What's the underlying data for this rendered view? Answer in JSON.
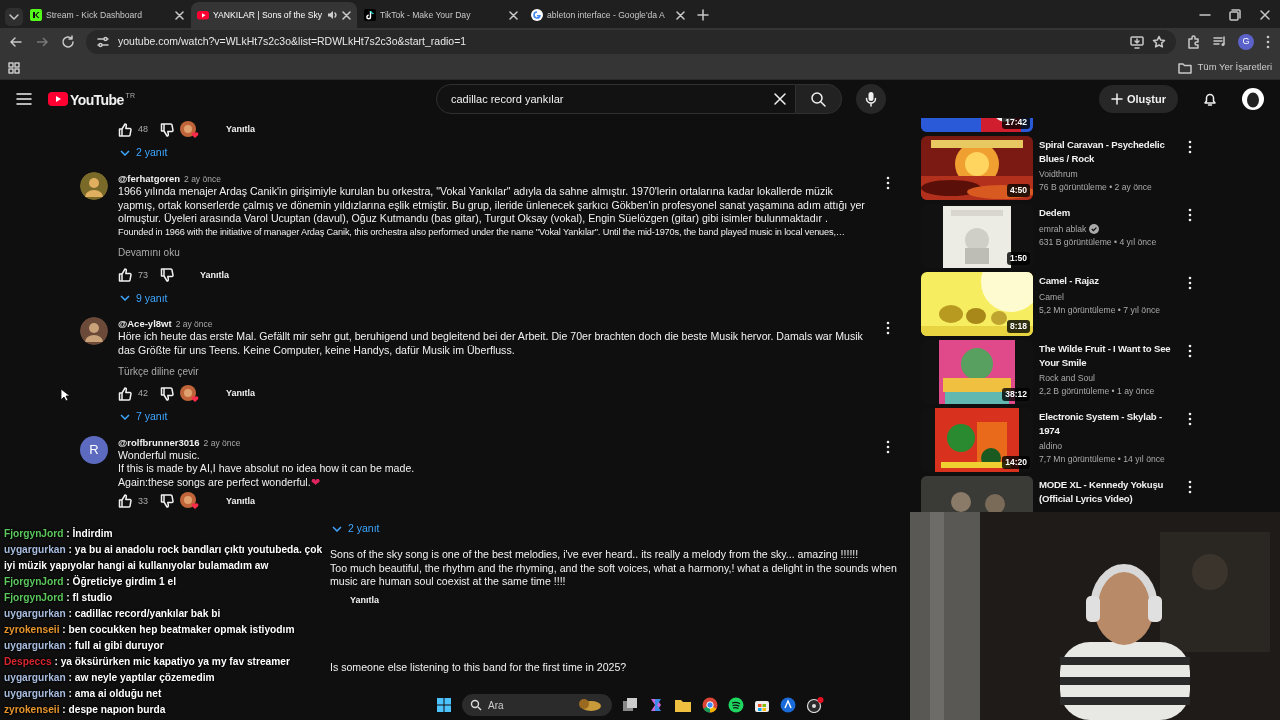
{
  "browser": {
    "tabs": [
      {
        "title": "Stream - Kick Dashboard",
        "selected": false,
        "audio": false
      },
      {
        "title": "YANKILAR | Sons of the Sky",
        "selected": true,
        "audio": true
      },
      {
        "title": "TikTok - Make Your Day",
        "selected": false,
        "audio": false
      },
      {
        "title": "ableton interface - Google'da A",
        "selected": false,
        "audio": false
      }
    ],
    "address": "youtube.com/watch?v=WLkHt7s2c3o&list=RDWLkHt7s2c3o&start_radio=1",
    "profile_letter": "G",
    "bookmarks_label": "Tüm Yer İşaretleri"
  },
  "youtube": {
    "logo": "YouTube",
    "country": "TR",
    "search": {
      "value": "cadillac record yankılar"
    },
    "create_label": "Oluştur"
  },
  "comments": [
    {
      "likes": "48",
      "creator_heart": true,
      "reply_label": "Yanıtla",
      "replies": "2 yanıt"
    },
    {
      "author": "@ferhatgoren",
      "time": "2 ay önce",
      "paragraphs": [
        "1966 yılında menajer Ardaş Canik'in girişimiyle kurulan bu orkestra, \"Vokal Yankılar\" adıyla da sahne almıştır. 1970'lerin ortalarına kadar lokallerde müzik yapmış, ortak konserlerde çalmış ve dönemin yıldızlarına eşlik etmiştir. Bu grup, ileride ünlenecek şarkıcı Gökben'in profesyonel sanat yaşamına adım attığı yer olmuştur. Üyeleri arasında Varol Ucuptan (davul), Oğuz Kutmandu (bas gitar), Turgut Oksay (vokal), Engin Süelözgen (gitar) gibi isimler bulunmaktadır .",
        "Founded in 1966 with the initiative of manager Ardaş Canik, this orchestra also performed under the name \"Vokal Yankılar\". Until the mid-1970s, the band played music in local venues,…"
      ],
      "expand": "Devamını oku",
      "likes": "73",
      "creator_heart": false,
      "reply_label": "Yanıtla",
      "replies": "9 yanıt"
    },
    {
      "author": "@Ace-yl8wt",
      "time": "2 ay önce",
      "paragraphs": [
        "Höre ich heute das erste Mal. Gefällt mir sehr gut, beruhigend und begleitend bei der Arbeit. Die 70er brachten doch die beste Musik hervor. Damals war Musik das Größte für uns Teens. Keine Computer, keine Handys, dafür Musik im Überfluss."
      ],
      "translate": "Türkçe diline çevir",
      "likes": "42",
      "creator_heart": true,
      "reply_label": "Yanıtla",
      "replies": "7 yanıt"
    },
    {
      "author": "@rolfbrunner3016",
      "time": "2 ay önce",
      "avatar_letter": "R",
      "paragraphs": [
        "Wonderful music.",
        "If this is made by AI,I have absolut no idea how it can be made.",
        "Again:these songs are perfect wonderful."
      ],
      "emoji": "❤",
      "likes": "33",
      "creator_heart": true,
      "reply_label": "Yanıtla"
    }
  ],
  "lower_comments": {
    "replies": "2 yanıt",
    "lines": [
      "Sons of the sky song is one of the best melodies, i've ever heard.. its really a melody from the sky... amazing !!!!!!",
      "Too much beautiful, the rhythm and the rhyming, and the soft voices, what a harmony,! what a delight in the sounds when music are human soul coexist at the  same time !!!!"
    ],
    "reply_label": "Yanıtla",
    "next_comment": "Is someone else listening to this band for the first time in 2025?"
  },
  "related_videos": [
    {
      "duration": "17:42"
    },
    {
      "title": "Spiral Caravan - Psychedelic Blues / Rock",
      "channel": "Voidthrum",
      "verified": false,
      "meta": "76 B görüntüleme • 2 ay önce",
      "duration": "4:50"
    },
    {
      "title": "Dedem",
      "channel": "emrah ablak",
      "verified": true,
      "meta": "631 B görüntüleme • 4 yıl önce",
      "duration": "1:50"
    },
    {
      "title": "Camel - Rajaz",
      "channel": "Camel",
      "verified": false,
      "meta": "5,2 Mn görüntüleme • 7 yıl önce",
      "duration": "8:18"
    },
    {
      "title": "The Wilde Fruit  -  I Want to See Your Smile",
      "channel": "Rock and Soul",
      "verified": false,
      "meta": "2,2 B görüntüleme • 1 ay önce",
      "duration": "38:12"
    },
    {
      "title": "Electronic System - Skylab - 1974",
      "channel": "aldino",
      "verified": false,
      "meta": "7,7 Mn görüntüleme • 14 yıl önce",
      "duration": "14:20"
    },
    {
      "title": "MODE XL -  Kennedy Yokuşu (Official Lyrics Video)"
    }
  ],
  "chat": [
    {
      "user": "FjorgynJord",
      "color": "#5cc75c",
      "message": ": İndirdim"
    },
    {
      "user": "uygargurkan",
      "color": "#a9bde0",
      "message": ": ya bu ai anadolu rock bandları çıktı youtubeda. çok iyi müzik yapıyolar hangi ai kullanıyolar bulamadım aw"
    },
    {
      "user": "FjorgynJord",
      "color": "#5cc75c",
      "message": ": Öğreticiye girdim 1 el"
    },
    {
      "user": "FjorgynJord",
      "color": "#5cc75c",
      "message": ": fl studio"
    },
    {
      "user": "uygargurkan",
      "color": "#a9bde0",
      "message": ": cadillac record/yankılar bak bi"
    },
    {
      "user": "zyrokenseii",
      "color": "#e8962e",
      "message": ": ben cocukken hep beatmaker opmak istiyodım"
    },
    {
      "user": "uygargurkan",
      "color": "#a9bde0",
      "message": ": full ai gibi duruyor"
    },
    {
      "user": "Despeccs",
      "color": "#d8262e",
      "message": ": ya öksürürken mic kapatiyo ya my fav streamer"
    },
    {
      "user": "uygargurkan",
      "color": "#a9bde0",
      "message": ": aw neyle yaptılar çözemedim"
    },
    {
      "user": "uygargurkan",
      "color": "#a9bde0",
      "message": ": ama ai olduğu net"
    },
    {
      "user": "zyrokenseii",
      "color": "#e8962e",
      "message": ": despe napıon burda"
    }
  ],
  "taskbar": {
    "search_placeholder": "Ara"
  }
}
